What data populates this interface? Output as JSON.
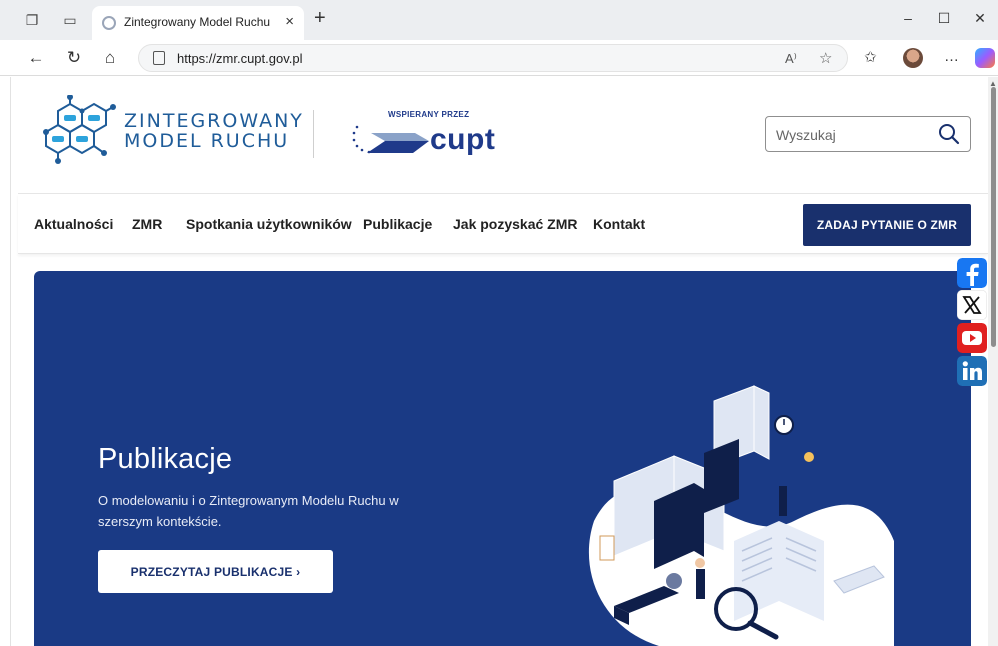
{
  "browser": {
    "tab_title": "Zintegrowany Model Ruchu",
    "url": "https://zmr.cupt.gov.pl",
    "reader_label": "A⁾",
    "more_label": "…"
  },
  "header": {
    "logo_line1": "ZINTEGROWANY",
    "logo_line2": "MODEL RUCHU",
    "supported_by": "WSPIERANY PRZEZ",
    "cupt_word": "cupt",
    "search_placeholder": "Wyszukaj"
  },
  "nav": {
    "items": [
      {
        "label": "Aktualności"
      },
      {
        "label": "ZMR"
      },
      {
        "label": "Spotkania użytkowników"
      },
      {
        "label": "Publikacje"
      },
      {
        "label": "Jak pozyskać ZMR"
      },
      {
        "label": "Kontakt"
      }
    ],
    "cta_label": "ZADAJ PYTANIE O ZMR"
  },
  "hero": {
    "title": "Publikacje",
    "subtitle": "O modelowaniu i o Zintegrowanym Modelu Ruchu w szerszym kontekście.",
    "button_label": "PRZECZYTAJ PUBLIKACJE  ›"
  },
  "social": {
    "icons": [
      "facebook-icon",
      "x-icon",
      "youtube-icon",
      "linkedin-icon"
    ]
  },
  "colors": {
    "brand_navy": "#19306d",
    "hero_bg": "#1a3a85",
    "logo_blue": "#1f5c99"
  }
}
